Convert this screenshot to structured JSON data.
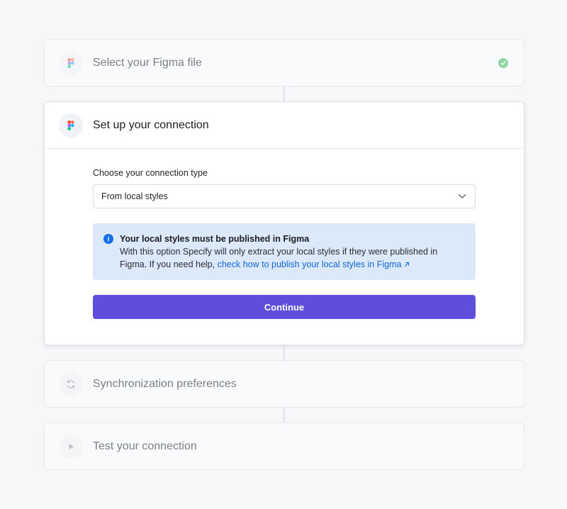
{
  "steps": [
    {
      "title": "Select your Figma file",
      "icon": "figma-icon",
      "state": "completed",
      "status_icon": "check-circle-icon"
    },
    {
      "title": "Set up your connection",
      "icon": "figma-icon",
      "state": "active"
    },
    {
      "title": "Synchronization preferences",
      "icon": "sync-icon",
      "state": "pending"
    },
    {
      "title": "Test your connection",
      "icon": "play-icon",
      "state": "pending"
    }
  ],
  "connection": {
    "field_label": "Choose your connection type",
    "selected_option": "From local styles",
    "dropdown_icon": "chevron-down-icon",
    "info": {
      "icon": "info-icon",
      "title": "Your local styles must be published in Figma",
      "body": "With this option Specify will only extract your local styles if they were published in Figma. If you need help,",
      "link_text": "check how to publish your local styles in Figma",
      "link_icon": "external-arrow-icon"
    },
    "continue_label": "Continue"
  },
  "colors": {
    "accent": "#5f4ddb",
    "info_bg": "#dce9fa",
    "link": "#1166d8",
    "success": "#8fd6a3"
  }
}
